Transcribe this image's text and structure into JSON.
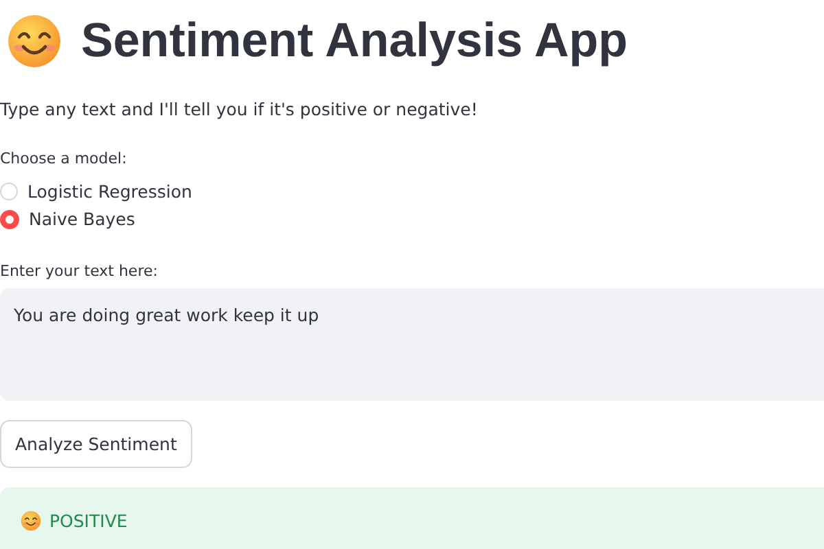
{
  "title": "Sentiment Analysis App",
  "subtitle": "Type any text and I'll tell you if it's positive or negative!",
  "model_choice": {
    "label": "Choose a model:",
    "options": [
      {
        "label": "Logistic Regression",
        "selected": false
      },
      {
        "label": "Naive Bayes",
        "selected": true
      }
    ]
  },
  "text_input": {
    "label": "Enter your text here:",
    "value": "You are doing great work keep it up"
  },
  "button": "Analyze Sentiment",
  "result": {
    "kind": "success",
    "text": "POSITIVE"
  }
}
